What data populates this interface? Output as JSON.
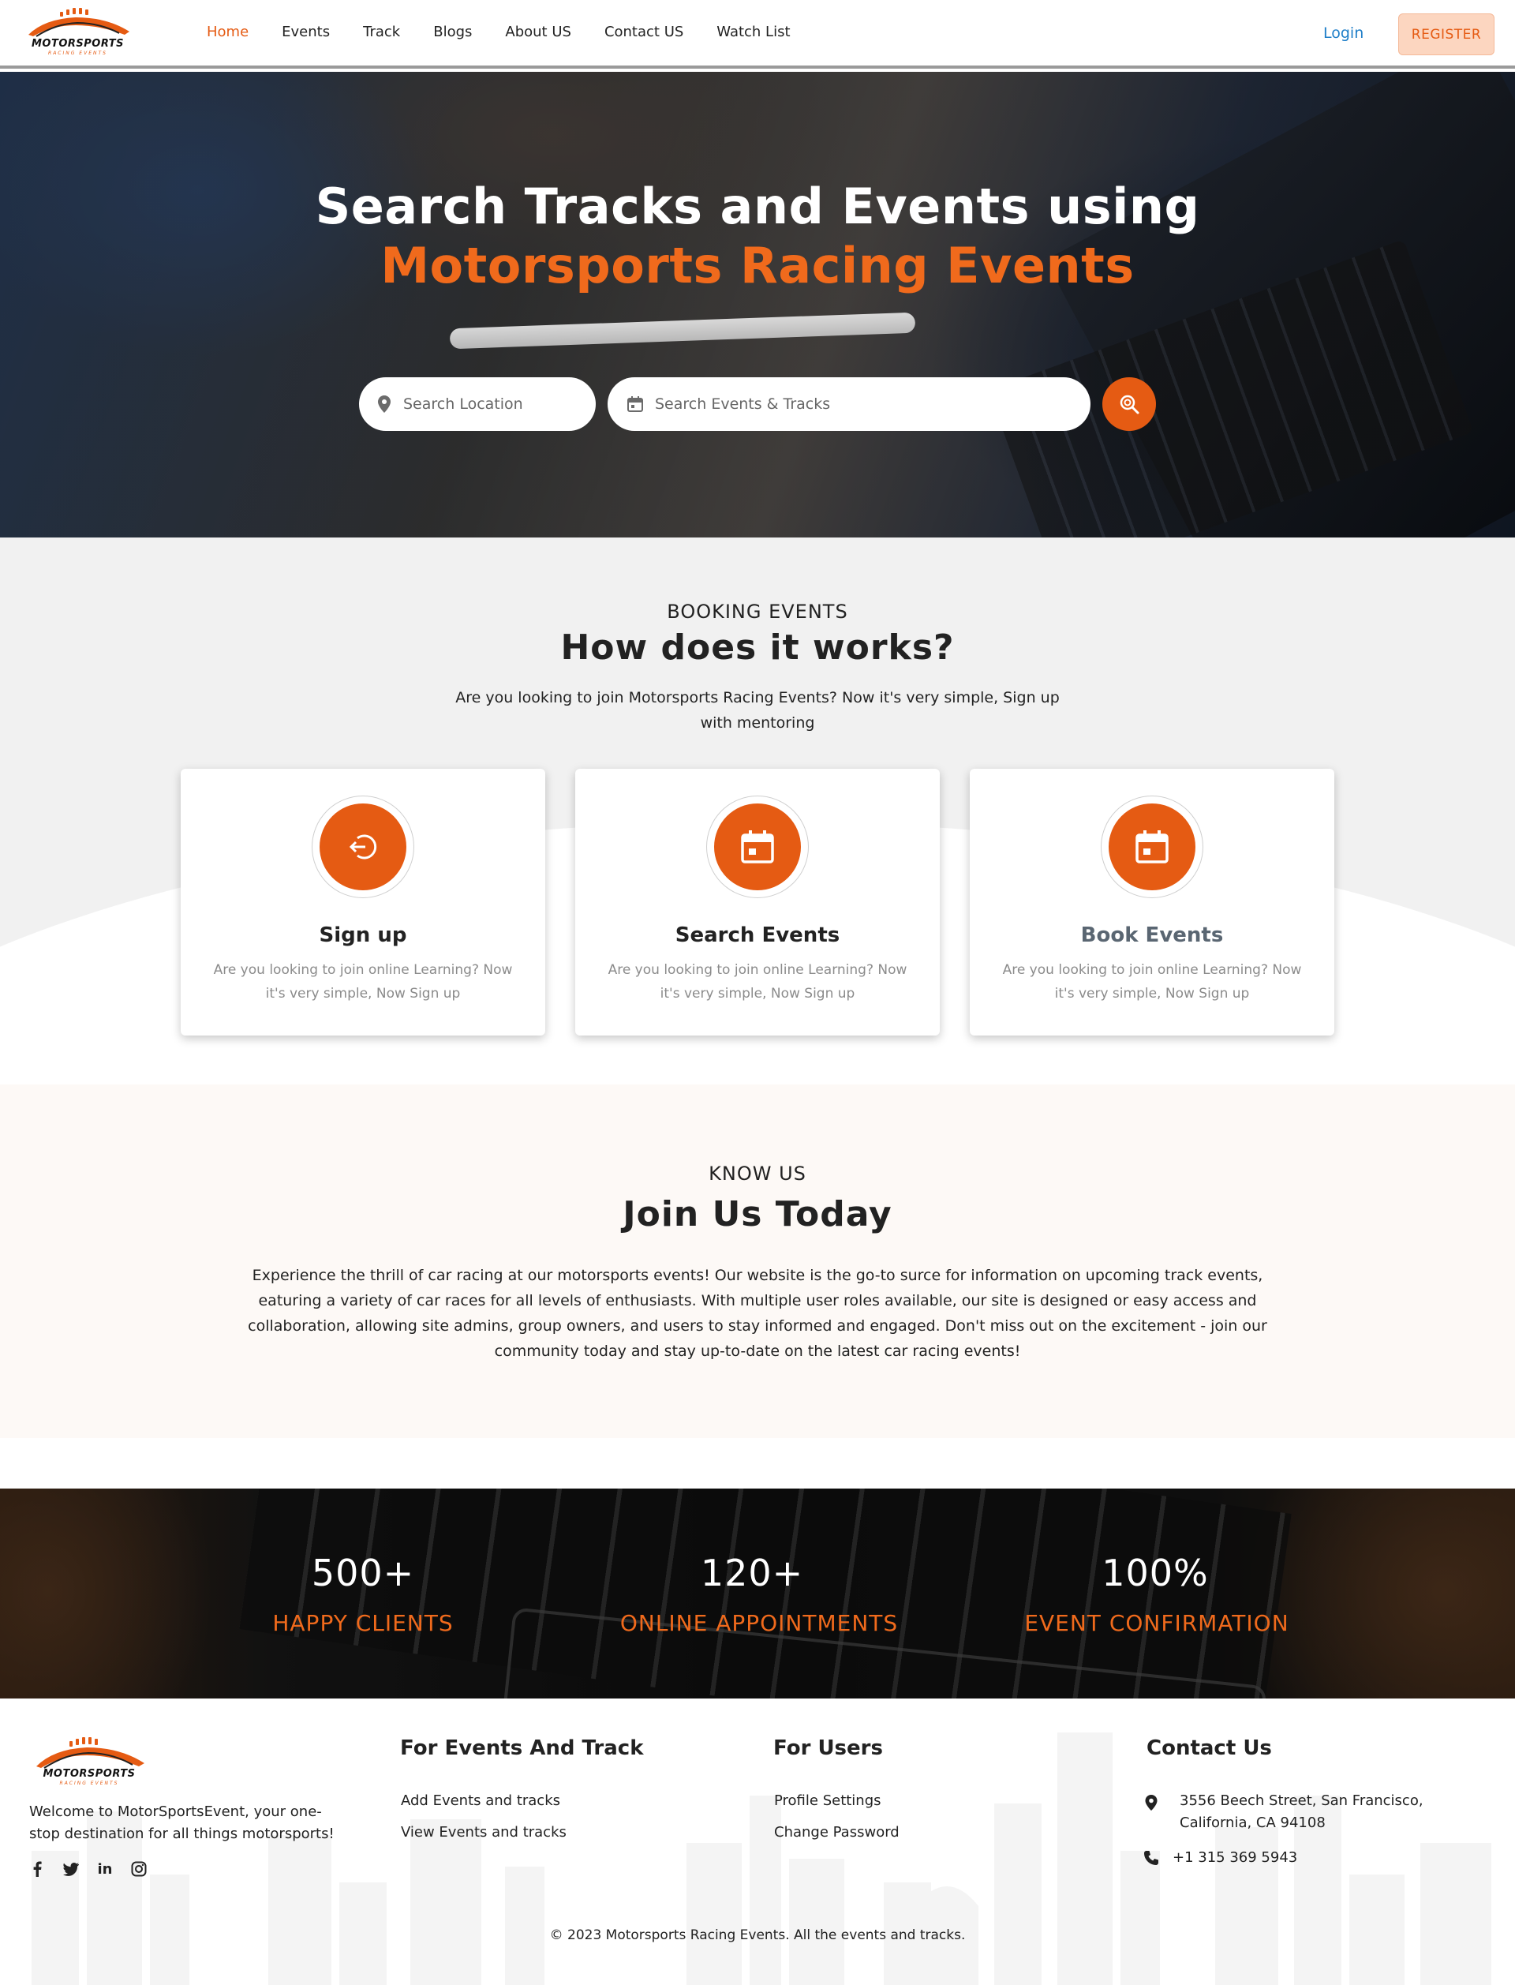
{
  "nav": {
    "logo_text": "MOTORSPORTS",
    "logo_sub": "RACING EVENTS",
    "links": [
      "Home",
      "Events",
      "Track",
      "Blogs",
      "About US",
      "Contact US",
      "Watch List"
    ],
    "active": "Home",
    "login": "Login",
    "register": "REGISTER"
  },
  "hero": {
    "title_line1": "Search Tracks and Events using",
    "title_line2": "Motorsports Racing Events",
    "location_placeholder": "Search Location",
    "events_placeholder": "Search Events & Tracks",
    "search_icon": "search-icon"
  },
  "how": {
    "eyebrow": "BOOKING EVENTS",
    "title": "How does it works?",
    "description": "Are you looking to join Motorsports Racing Events? Now it's very simple, Sign up with mentoring",
    "cards": [
      {
        "title": "Sign up",
        "icon": "sign-in-icon",
        "description": "Are you looking to join online Learning? Now it's very simple, Now Sign up"
      },
      {
        "title": "Search Events",
        "icon": "calendar-icon",
        "description": "Are you looking to join online Learning? Now it's very simple, Now Sign up"
      },
      {
        "title": "Book Events",
        "icon": "calendar-icon",
        "description": "Are you looking to join online Learning? Now it's very simple, Now Sign up"
      }
    ]
  },
  "know": {
    "eyebrow": "KNOW US",
    "title": "Join Us Today",
    "description": "Experience the thrill of car racing at our motorsports events! Our website is the go-to surce for information on upcoming track events, eaturing a variety of car races for all levels of enthusiasts. With multiple user roles available, our site is designed or easy access and collaboration, allowing site admins, group owners, and users to stay informed and engaged. Don't miss out on the excitement - join our community today and stay up-to-date on the latest car racing events!"
  },
  "stats": [
    {
      "value": "500+",
      "label": "HAPPY CLIENTS"
    },
    {
      "value": "120+",
      "label": "ONLINE APPOINTMENTS"
    },
    {
      "value": "100%",
      "label": "EVENT CONFIRMATION"
    }
  ],
  "footer": {
    "welcome": "Welcome to MotorSportsEvent, your one-stop destination for all things motorsports!",
    "socials": [
      "facebook-icon",
      "twitter-icon",
      "linkedin-icon",
      "instagram-icon"
    ],
    "events_heading": "For Events And Track",
    "events_links": [
      "Add Events and tracks",
      "View Events and tracks"
    ],
    "users_heading": "For Users",
    "users_links": [
      "Profile Settings",
      "Change Password"
    ],
    "contact_heading": "Contact Us",
    "address": "3556 Beech Street, San Francisco, California, CA 94108",
    "phone": "+1 315 369 5943",
    "copyright": "© 2023 Motorsports Racing Events. All the events and tracks."
  },
  "colors": {
    "accent": "#e55b13",
    "accent_light": "#fcd6c0",
    "link_blue": "#1e7ec8"
  }
}
